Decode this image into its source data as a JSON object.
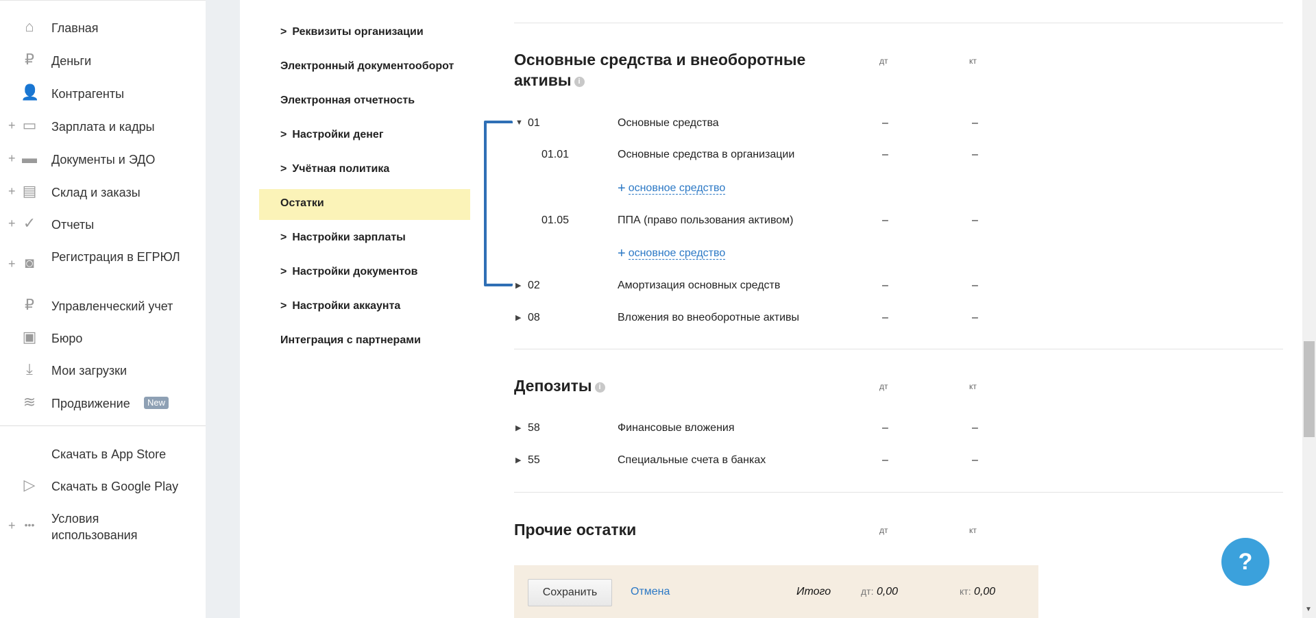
{
  "sidebar": {
    "items": [
      {
        "label": "Главная",
        "icon": "home-icon",
        "plus": false
      },
      {
        "label": "Деньги",
        "icon": "money-icon",
        "plus": false
      },
      {
        "label": "Контрагенты",
        "icon": "contractors-icon",
        "plus": false
      },
      {
        "label": "Зарплата и кадры",
        "icon": "wallet-icon",
        "plus": true
      },
      {
        "label": "Документы и ЭДО",
        "icon": "folder-icon",
        "plus": true
      },
      {
        "label": "Склад и заказы",
        "icon": "cart-icon",
        "plus": true
      },
      {
        "label": "Отчеты",
        "icon": "report-icon",
        "plus": true
      },
      {
        "label": "Регистрация в ЕГРЮЛ",
        "icon": "registration-icon",
        "plus": true
      },
      {
        "label": "Управленческий учет",
        "icon": "management-icon",
        "plus": false
      },
      {
        "label": "Бюро",
        "icon": "briefcase-icon",
        "plus": false
      },
      {
        "label": "Мои загрузки",
        "icon": "download-icon",
        "plus": false
      },
      {
        "label": "Продвижение",
        "icon": "chart-icon",
        "plus": false,
        "badge": "New"
      }
    ],
    "extra": [
      {
        "label": "Скачать в App Store",
        "icon": "apple-icon"
      },
      {
        "label": "Скачать в Google Play",
        "icon": "google-play-icon"
      },
      {
        "label": "Условия использования",
        "icon": "more-icon",
        "plus": true
      }
    ]
  },
  "settings_nav": [
    {
      "label": "Реквизиты организации",
      "chevron": true
    },
    {
      "label": "Электронный документооборот",
      "chevron": false
    },
    {
      "label": "Электронная отчетность",
      "chevron": false
    },
    {
      "label": "Настройки денег",
      "chevron": true
    },
    {
      "label": "Учётная политика",
      "chevron": true
    },
    {
      "label": "Остатки",
      "chevron": false,
      "active": true
    },
    {
      "label": "Настройки зарплаты",
      "chevron": true
    },
    {
      "label": "Настройки документов",
      "chevron": true
    },
    {
      "label": "Настройки аккаунта",
      "chevron": true
    },
    {
      "label": "Интеграция с партнерами",
      "chevron": false
    }
  ],
  "columns": {
    "dt": "дт",
    "kt": "кт"
  },
  "sections": {
    "fixed": {
      "title": "Основные средства и внеоборотные активы",
      "rows": [
        {
          "code": "01",
          "name": "Основные средства",
          "dt": "–",
          "kt": "–",
          "expanded": true
        },
        {
          "code": "01.01",
          "name": "Основные средства в организации",
          "dt": "–",
          "kt": "–"
        },
        {
          "code": "01.05",
          "name": "ППА (право пользования активом)",
          "dt": "–",
          "kt": "–"
        },
        {
          "code": "02",
          "name": "Амортизация основных средств",
          "dt": "–",
          "kt": "–"
        },
        {
          "code": "08",
          "name": "Вложения во внеоборотные активы",
          "dt": "–",
          "kt": "–"
        }
      ],
      "add_link": "основное средство"
    },
    "deposits": {
      "title": "Депозиты",
      "rows": [
        {
          "code": "58",
          "name": "Финансовые вложения",
          "dt": "–",
          "kt": "–"
        },
        {
          "code": "55",
          "name": "Специальные счета в банках",
          "dt": "–",
          "kt": "–"
        }
      ]
    },
    "other": {
      "title": "Прочие остатки"
    }
  },
  "footer": {
    "save": "Сохранить",
    "cancel": "Отмена",
    "total_label": "Итого",
    "dt_label": "дт:",
    "dt_value": "0,00",
    "kt_label": "кт:",
    "kt_value": "0,00"
  },
  "help": "?"
}
